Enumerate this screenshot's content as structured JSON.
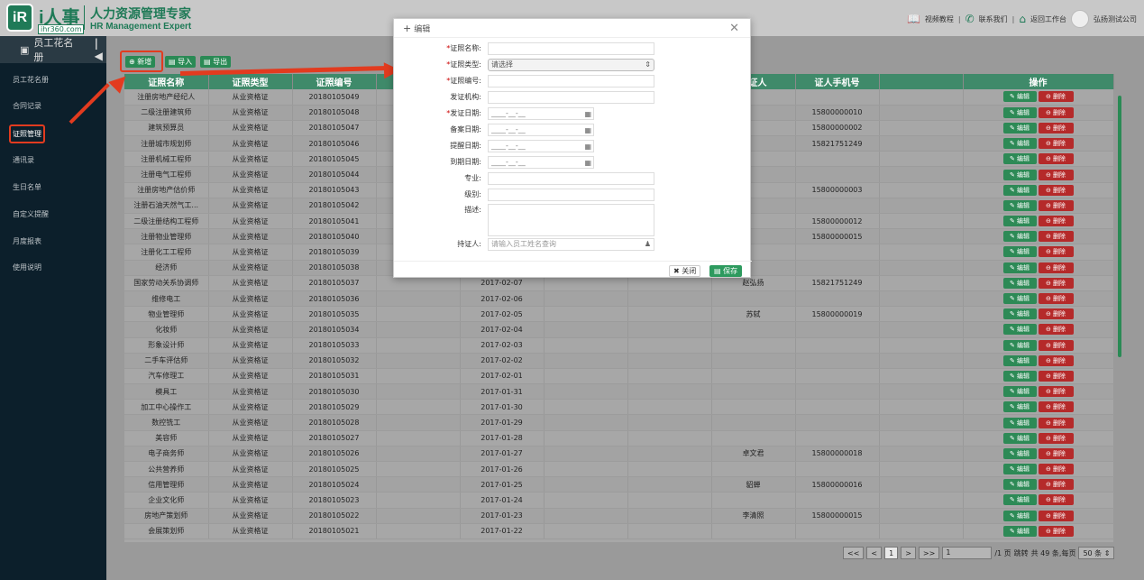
{
  "header": {
    "logo_mark": "iR",
    "logo_main": "i人事",
    "logo_site": "ihr360.com",
    "logo_cn": "人力资源管理专家",
    "logo_en": "HR Management Expert",
    "links": [
      "视频教程",
      "联系我们",
      "返回工作台"
    ],
    "company": "弘扬测试公司"
  },
  "sidebar": {
    "title": "员工花名册",
    "items": [
      "员工花名册",
      "合同记录",
      "证照管理",
      "通讯录",
      "生日名单",
      "自定义提醒",
      "月度报表",
      "使用说明"
    ],
    "active_index": 2
  },
  "toolbar": {
    "add": "新增",
    "import": "导入",
    "export": "导出"
  },
  "table": {
    "columns": [
      "证照名称",
      "证照类型",
      "证照编号",
      "",
      "",
      "",
      "持证人",
      "证人手机号",
      "操作"
    ],
    "edit_label": "编辑",
    "delete_label": "删除",
    "rows": [
      [
        "注册房地产经纪人",
        "从业资格证",
        "20180105049",
        "",
        "",
        "",
        "",
        ""
      ],
      [
        "二级注册建筑师",
        "从业资格证",
        "20180105048",
        "",
        "",
        "",
        "",
        "15800000010"
      ],
      [
        "建筑预算员",
        "从业资格证",
        "20180105047",
        "",
        "",
        "",
        "",
        "15800000002"
      ],
      [
        "注册城市规划师",
        "从业资格证",
        "20180105046",
        "",
        "",
        "",
        "",
        "15821751249"
      ],
      [
        "注册机械工程师",
        "从业资格证",
        "20180105045",
        "",
        "",
        "",
        "",
        ""
      ],
      [
        "注册电气工程师",
        "从业资格证",
        "20180105044",
        "",
        "",
        "",
        "",
        ""
      ],
      [
        "注册房地产估价师",
        "从业资格证",
        "20180105043",
        "",
        "",
        "",
        "",
        "15800000003"
      ],
      [
        "注册石油天然气工...",
        "从业资格证",
        "20180105042",
        "",
        "",
        "",
        "",
        ""
      ],
      [
        "二级注册结构工程师",
        "从业资格证",
        "20180105041",
        "",
        "",
        "",
        "",
        "15800000012"
      ],
      [
        "注册物业管理师",
        "从业资格证",
        "20180105040",
        "",
        "",
        "",
        "",
        "15800000015"
      ],
      [
        "注册化工工程师",
        "从业资格证",
        "20180105039",
        "",
        "",
        "",
        "",
        ""
      ],
      [
        "经济师",
        "从业资格证",
        "20180105038",
        "",
        "",
        "",
        "",
        ""
      ],
      [
        "国家劳动关系协调师",
        "从业资格证",
        "20180105037",
        "2017-02-07",
        "",
        "赵弘扬",
        "15821751249",
        ""
      ],
      [
        "维修电工",
        "从业资格证",
        "20180105036",
        "2017-02-06",
        "",
        "",
        "",
        ""
      ],
      [
        "物业管理师",
        "从业资格证",
        "20180105035",
        "2017-02-05",
        "",
        "苏轼",
        "15800000019",
        ""
      ],
      [
        "化妆师",
        "从业资格证",
        "20180105034",
        "2017-02-04",
        "",
        "",
        "",
        ""
      ],
      [
        "形象设计师",
        "从业资格证",
        "20180105033",
        "2017-02-03",
        "",
        "",
        "",
        ""
      ],
      [
        "二手车评估师",
        "从业资格证",
        "20180105032",
        "2017-02-02",
        "",
        "",
        "",
        ""
      ],
      [
        "汽车修理工",
        "从业资格证",
        "20180105031",
        "2017-02-01",
        "",
        "",
        "",
        ""
      ],
      [
        "模具工",
        "从业资格证",
        "20180105030",
        "2017-01-31",
        "",
        "",
        "",
        ""
      ],
      [
        "加工中心操作工",
        "从业资格证",
        "20180105029",
        "2017-01-30",
        "",
        "",
        "",
        ""
      ],
      [
        "数控铣工",
        "从业资格证",
        "20180105028",
        "2017-01-29",
        "",
        "",
        "",
        ""
      ],
      [
        "美容师",
        "从业资格证",
        "20180105027",
        "2017-01-28",
        "",
        "",
        "",
        ""
      ],
      [
        "电子商务师",
        "从业资格证",
        "20180105026",
        "2017-01-27",
        "",
        "卓文君",
        "15800000018",
        ""
      ],
      [
        "公共营养师",
        "从业资格证",
        "20180105025",
        "2017-01-26",
        "",
        "",
        "",
        ""
      ],
      [
        "信用管理师",
        "从业资格证",
        "20180105024",
        "2017-01-25",
        "",
        "貂蝉",
        "15800000016",
        ""
      ],
      [
        "企业文化师",
        "从业资格证",
        "20180105023",
        "2017-01-24",
        "",
        "",
        "",
        ""
      ],
      [
        "房地产策划师",
        "从业资格证",
        "20180105022",
        "2017-01-23",
        "",
        "李清照",
        "15800000015",
        ""
      ],
      [
        "会展策划师",
        "从业资格证",
        "20180105021",
        "2017-01-22",
        "",
        "",
        "",
        ""
      ]
    ]
  },
  "pager": {
    "first": "<<",
    "prev": "<",
    "current": "1",
    "next": ">",
    "last": ">>",
    "page_input": "1",
    "total_pages": "/1 页",
    "jump": "跳转",
    "summary": "共 49 条,每页",
    "per_page": "50 条"
  },
  "modal": {
    "title": "编辑",
    "fields": [
      {
        "label": "证照名称:",
        "required": true,
        "value": ""
      },
      {
        "label": "证照类型:",
        "required": true,
        "value": "请选择"
      },
      {
        "label": "证照编号:",
        "required": true,
        "value": ""
      },
      {
        "label": "发证机构:",
        "required": false,
        "value": ""
      },
      {
        "label": "发证日期:",
        "required": true,
        "value": "____-__-__"
      },
      {
        "label": "备案日期:",
        "required": false,
        "value": "____-__-__"
      },
      {
        "label": "提醒日期:",
        "required": false,
        "value": "____-__-__"
      },
      {
        "label": "到期日期:",
        "required": false,
        "value": "____-__-__"
      },
      {
        "label": "专业:",
        "required": false,
        "value": ""
      },
      {
        "label": "级别:",
        "required": false,
        "value": ""
      },
      {
        "label": "描述:",
        "required": false,
        "value": ""
      },
      {
        "label": "持证人:",
        "required": false,
        "value": "",
        "placeholder": "请输入员工姓名查询"
      }
    ],
    "close": "关闭",
    "save": "保存"
  }
}
